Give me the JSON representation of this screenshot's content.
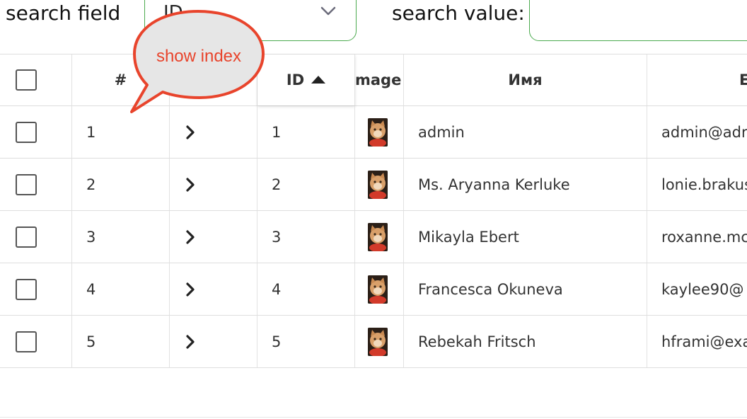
{
  "search": {
    "field_label": "search field",
    "field_value": "ID",
    "value_label": "search value:",
    "value_placeholder": ""
  },
  "callout": {
    "text": "show index"
  },
  "table": {
    "headers": {
      "index": "#",
      "id": "ID",
      "image": "mage",
      "name": "Имя",
      "email": "E"
    },
    "sort": {
      "column": "ID",
      "direction": "ascending"
    },
    "rows": [
      {
        "index": "1",
        "id": "1",
        "name": "admin",
        "email": "admin@adr"
      },
      {
        "index": "2",
        "id": "2",
        "name": "Ms. Aryanna Kerluke",
        "email": "lonie.brakus"
      },
      {
        "index": "3",
        "id": "3",
        "name": "Mikayla Ebert",
        "email": "roxanne.mc"
      },
      {
        "index": "4",
        "id": "4",
        "name": "Francesca Okuneva",
        "email": "kaylee90@"
      },
      {
        "index": "5",
        "id": "5",
        "name": "Rebekah Fritsch",
        "email": "hframi@exa"
      }
    ]
  },
  "colors": {
    "accent_border": "#4caa4f",
    "callout_red": "#e8442c",
    "callout_fill": "#e6e6e6"
  }
}
